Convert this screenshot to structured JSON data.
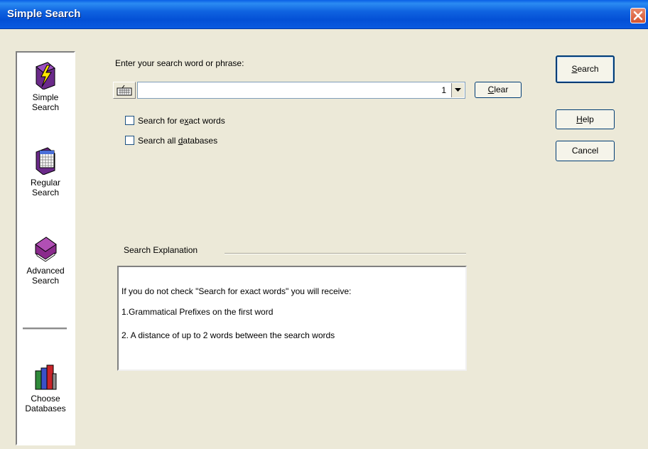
{
  "window": {
    "title": "Simple Search"
  },
  "nav": {
    "items": [
      {
        "line1": "Simple",
        "line2": "Search",
        "icon": "lightning-icon"
      },
      {
        "line1": "Regular",
        "line2": "Search",
        "icon": "calendar-grid-icon"
      },
      {
        "line1": "Advanced",
        "line2": "Search",
        "icon": "book-icon"
      },
      {
        "line1": "Choose",
        "line2": "Databases",
        "icon": "books-icon"
      }
    ]
  },
  "search": {
    "prompt": "Enter your search word or phrase:",
    "value": "",
    "counter": "1",
    "clear_label_mnemonic": "C",
    "clear_label_rest": "lear"
  },
  "options": {
    "exact_pre": "Search for e",
    "exact_mn": "x",
    "exact_post": "act words",
    "all_pre": "Search all ",
    "all_mn": "d",
    "all_post": "atabases"
  },
  "buttons": {
    "search_mn": "S",
    "search_rest": "earch",
    "help_mn": "H",
    "help_rest": "elp",
    "cancel": "Cancel"
  },
  "explanation": {
    "title": "Search Explanation",
    "lines": [
      "If you do not check \"Search for exact words\" you will receive:",
      "1.Grammatical Prefixes on the first word",
      "2. A distance of up to 2 words between the search words"
    ]
  },
  "colors": {
    "titlebar": "#0A5FE6",
    "dialog": "#ECE9D8",
    "button_border": "#003C74"
  }
}
